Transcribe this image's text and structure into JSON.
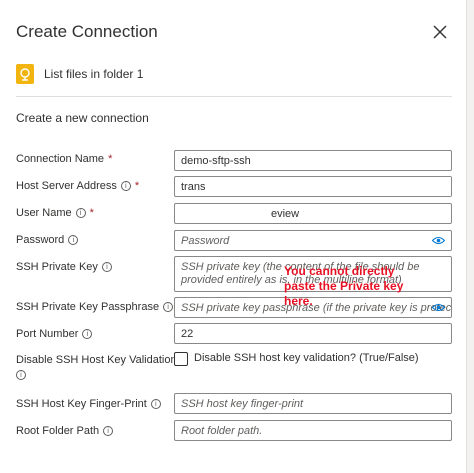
{
  "panel": {
    "title": "Create Connection",
    "action_label": "List files in folder 1",
    "section_title": "Create a new connection"
  },
  "fields": {
    "connection_name": {
      "label": "Connection Name",
      "value": "demo-sftp-ssh"
    },
    "host_server_address": {
      "label": "Host Server Address",
      "value": "trans"
    },
    "user_name": {
      "label": "User Name",
      "value": "eview"
    },
    "password": {
      "label": "Password",
      "placeholder": "Password"
    },
    "ssh_private_key": {
      "label": "SSH Private Key",
      "placeholder": "SSH private key (the content of the file should be provided entirely as is, in the multiline format)"
    },
    "ssh_private_key_passphrase": {
      "label": "SSH Private Key Passphrase",
      "placeholder": "SSH private key passphrase (if the private key is protec..."
    },
    "port_number": {
      "label": "Port Number",
      "value": "22"
    },
    "disable_ssh_host_key_validation": {
      "label_line1": "Disable SSH Host Key Validation",
      "checkbox_label": "Disable SSH host key validation? (True/False)",
      "checked": false
    },
    "ssh_host_key_fingerprint": {
      "label": "SSH Host Key Finger-Print",
      "placeholder": "SSH host key finger-print"
    },
    "root_folder_path": {
      "label": "Root Folder Path",
      "placeholder": "Root folder path."
    }
  },
  "annotation": {
    "text": "You cannot directly paste the Private key here."
  },
  "colors": {
    "accent": "#0078d4",
    "required": "#a4262c",
    "annotation": "#e81123",
    "action_icon": "#f2b40f"
  },
  "icons": {
    "close": "close-icon",
    "action": "sftp-connector-icon",
    "info": "info-icon",
    "eye": "eye-icon"
  }
}
